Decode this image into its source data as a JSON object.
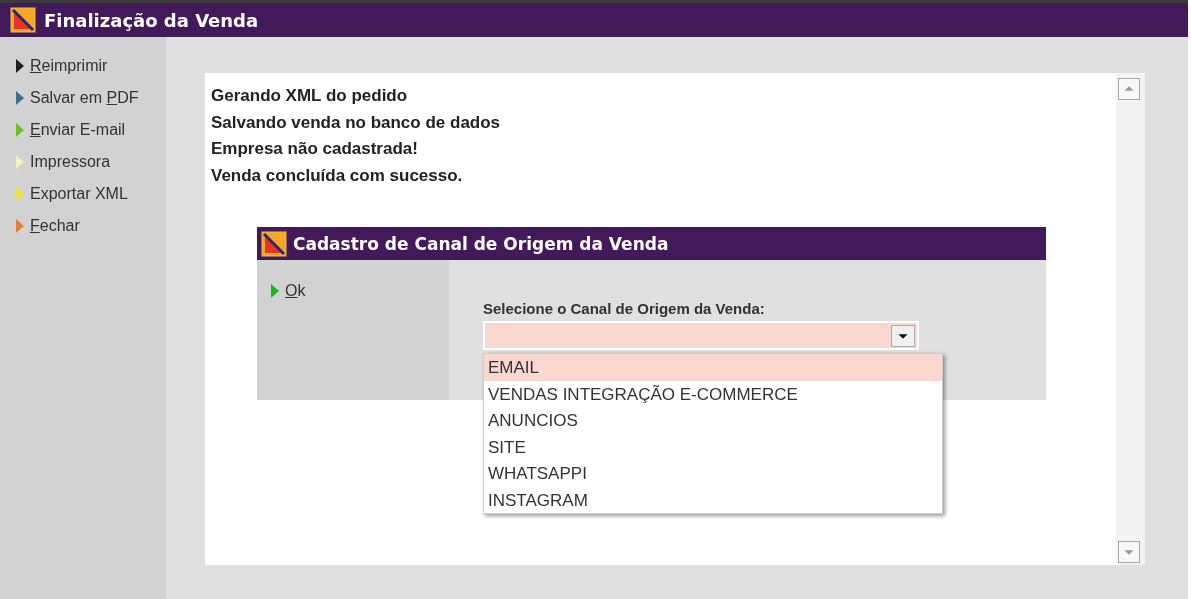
{
  "window": {
    "title": "Finalização da Venda"
  },
  "sidebar": {
    "items": [
      {
        "label": {
          "key": "R",
          "after": "eimprimir"
        },
        "color": "#202020"
      },
      {
        "label": {
          "before": "Salvar em ",
          "key": "P",
          "after": "DF"
        },
        "color": "#3d6f8e"
      },
      {
        "label": {
          "key": "E",
          "after": "nviar E-mail"
        },
        "color": "#6cbf2a"
      },
      {
        "label": {
          "before": "Impressora"
        },
        "color": "#f2f2c0"
      },
      {
        "label": {
          "before": "Exportar XML"
        },
        "color": "#ece23a"
      },
      {
        "label": {
          "key": "F",
          "after": "echar"
        },
        "color": "#e0803a"
      }
    ]
  },
  "log": {
    "lines": [
      "Gerando XML do pedido",
      "Salvando venda no banco de dados",
      "Empresa não cadastrada!",
      "Venda concluída com sucesso."
    ]
  },
  "dialog": {
    "title": "Cadastro de Canal de Origem da Venda",
    "actions": [
      {
        "label": {
          "key": "O",
          "after": "k"
        },
        "color": "#1db81d"
      }
    ],
    "field_label": "Selecione o Canal de Origem da Venda:",
    "dropdown": {
      "expanded": true,
      "options": [
        {
          "label": "EMAIL",
          "selected": true
        },
        {
          "label": "VENDAS INTEGRAÇÃO E-COMMERCE",
          "selected": false
        },
        {
          "label": "ANUNCIOS",
          "selected": false
        },
        {
          "label": "SITE",
          "selected": false
        },
        {
          "label": "WHATSAPPI",
          "selected": false
        },
        {
          "label": "INSTAGRAM",
          "selected": false
        }
      ]
    }
  }
}
